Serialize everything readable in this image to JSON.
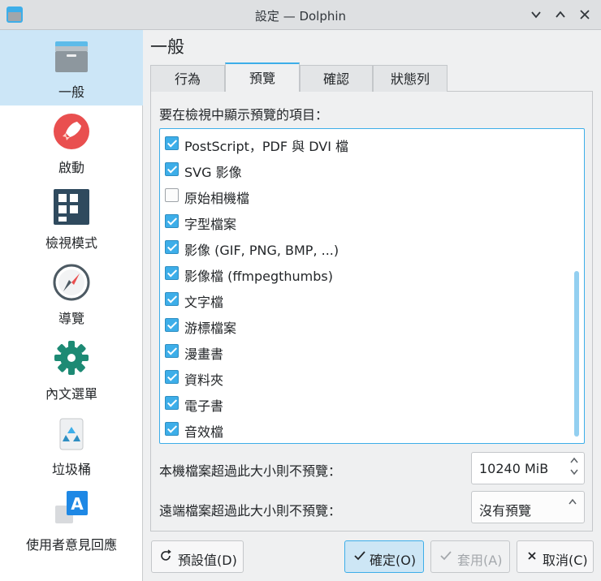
{
  "window": {
    "title": "設定 — Dolphin"
  },
  "page_title": "一般",
  "sidebar": {
    "items": [
      {
        "label": "一般"
      },
      {
        "label": "啟動"
      },
      {
        "label": "檢視模式"
      },
      {
        "label": "導覽"
      },
      {
        "label": "內文選單"
      },
      {
        "label": "垃圾桶"
      },
      {
        "label": "使用者意見回應"
      }
    ]
  },
  "tabs": [
    {
      "label": "行為"
    },
    {
      "label": "預覽"
    },
    {
      "label": "確認"
    },
    {
      "label": "狀態列"
    }
  ],
  "preview": {
    "section_label": "要在檢視中顯示預覽的項目：",
    "items": [
      {
        "label": "PostScript，PDF 與 DVI 檔",
        "checked": true
      },
      {
        "label": "SVG 影像",
        "checked": true
      },
      {
        "label": "原始相機檔",
        "checked": false
      },
      {
        "label": "字型檔案",
        "checked": true
      },
      {
        "label": "影像 (GIF, PNG, BMP, ...)",
        "checked": true
      },
      {
        "label": "影像檔 (ffmpegthumbs)",
        "checked": true
      },
      {
        "label": "文字檔",
        "checked": true
      },
      {
        "label": "游標檔案",
        "checked": true
      },
      {
        "label": "漫畫書",
        "checked": true
      },
      {
        "label": "資料夾",
        "checked": true
      },
      {
        "label": "電子書",
        "checked": true
      },
      {
        "label": "音效檔",
        "checked": true
      }
    ],
    "local_label": "本機檔案超過此大小則不預覽：",
    "local_value": "10240 MiB",
    "remote_label": "遠端檔案超過此大小則不預覽：",
    "remote_value": "沒有預覽"
  },
  "buttons": {
    "defaults": "預設值(D)",
    "ok": "確定(O)",
    "apply": "套用(A)",
    "cancel": "取消(C)"
  },
  "colors": {
    "accent": "#3daee9",
    "selection": "#cce6f7"
  }
}
